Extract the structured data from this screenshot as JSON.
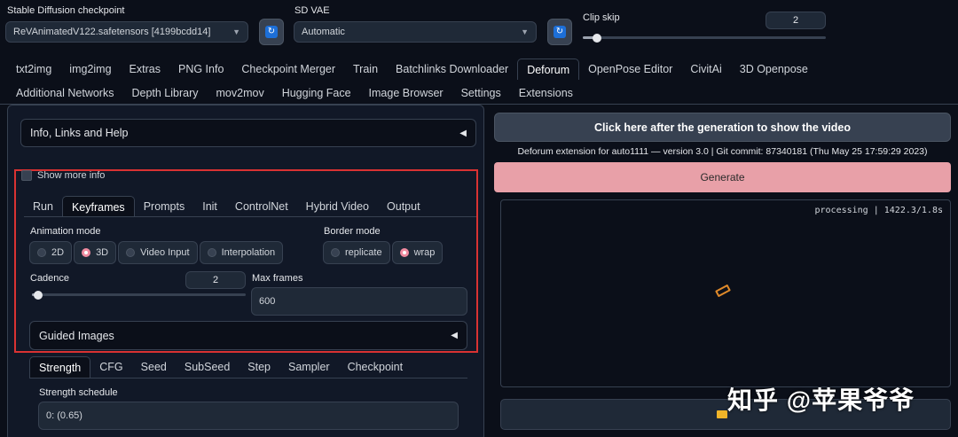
{
  "top": {
    "checkpoint_label": "Stable Diffusion checkpoint",
    "checkpoint_value": "ReVAnimatedV122.safetensors [4199bcdd14]",
    "vae_label": "SD VAE",
    "vae_value": "Automatic",
    "clip_skip_label": "Clip skip",
    "clip_skip_value": "2",
    "clip_skip_fraction": 0.06
  },
  "main_tabs_row1": [
    "txt2img",
    "img2img",
    "Extras",
    "PNG Info",
    "Checkpoint Merger",
    "Train",
    "Batchlinks Downloader",
    "Deforum",
    "OpenPose Editor",
    "CivitAi",
    "3D Openpose"
  ],
  "main_tabs_row2": [
    "Additional Networks",
    "Depth Library",
    "mov2mov",
    "Hugging Face",
    "Image Browser",
    "Settings",
    "Extensions"
  ],
  "selected_main_tab": "Deforum",
  "left": {
    "info_accordion": "Info, Links and Help",
    "show_more_info": "Show more info",
    "sub_tabs": [
      "Run",
      "Keyframes",
      "Prompts",
      "Init",
      "ControlNet",
      "Hybrid Video",
      "Output"
    ],
    "selected_sub_tab": "Keyframes",
    "animation_mode_label": "Animation mode",
    "animation_modes": [
      "2D",
      "3D",
      "Video Input",
      "Interpolation"
    ],
    "animation_mode_selected": "3D",
    "border_mode_label": "Border mode",
    "border_modes": [
      "replicate",
      "wrap"
    ],
    "border_mode_selected": "wrap",
    "cadence_label": "Cadence",
    "cadence_value": "2",
    "cadence_fraction": 0.03,
    "max_frames_label": "Max frames",
    "max_frames_value": "600",
    "guided_images": "Guided Images",
    "schedule_tabs": [
      "Strength",
      "CFG",
      "Seed",
      "SubSeed",
      "Step",
      "Sampler",
      "Checkpoint"
    ],
    "selected_schedule_tab": "Strength",
    "strength_schedule_label": "Strength schedule",
    "strength_schedule_value": "0: (0.65)"
  },
  "right": {
    "show_video_button": "Click here after the generation to show the video",
    "version_text": "Deforum extension for auto1111 — version 3.0 | Git commit: 87340181 (Thu May 25 17:59:29 2023)",
    "generate_button": "Generate",
    "processing_text": "processing | 1422.3/1.8s"
  },
  "watermark": "知乎 @苹果爷爷",
  "colors": {
    "background": "#0b0f19",
    "panel": "#111827",
    "generate": "#e8a0a8",
    "highlight_box": "#d93232",
    "radio_selected": "#f08ba0"
  }
}
